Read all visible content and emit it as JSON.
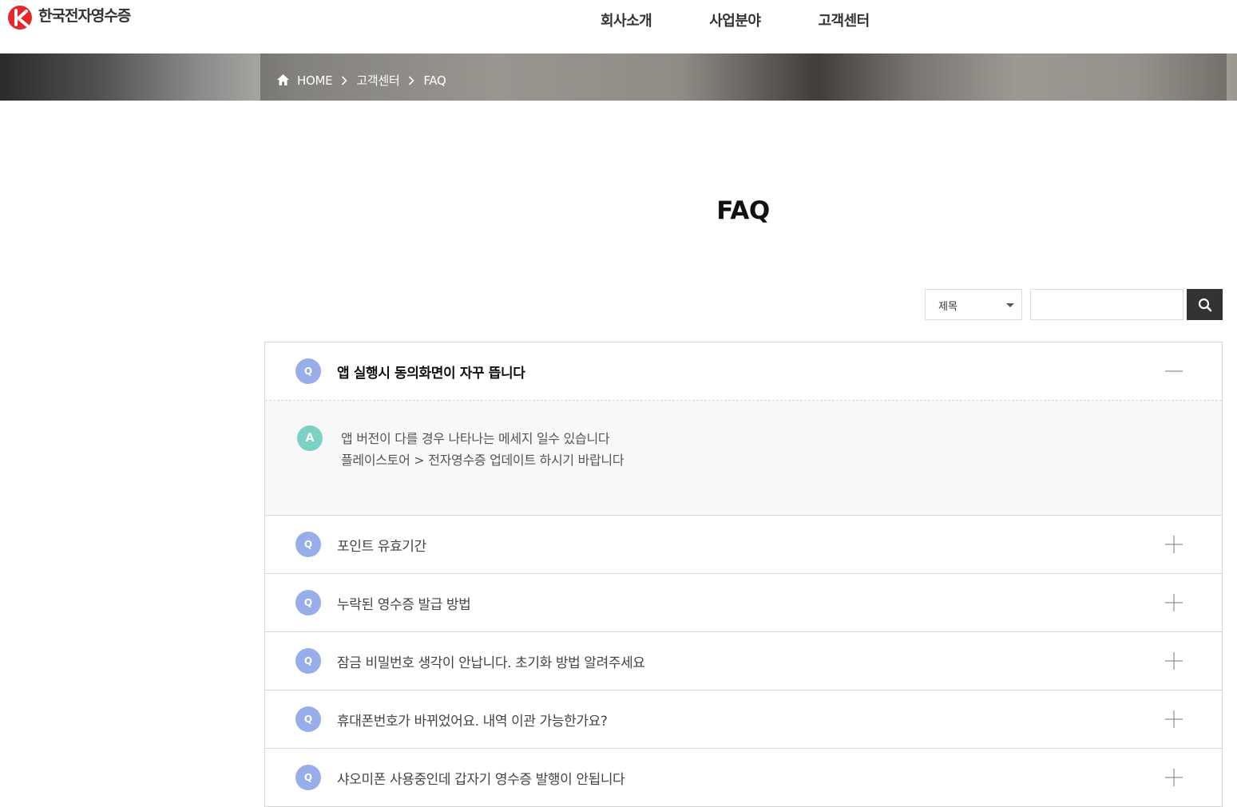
{
  "header": {
    "logo_text": "한국전자영수증",
    "nav": [
      {
        "label": "회사소개"
      },
      {
        "label": "사업분야"
      },
      {
        "label": "고객센터"
      }
    ]
  },
  "breadcrumb": {
    "home": "HOME",
    "section": "고객센터",
    "current": "FAQ"
  },
  "page": {
    "title": "FAQ"
  },
  "search": {
    "field_selected": "제목",
    "query": ""
  },
  "faq": [
    {
      "q_badge": "Q",
      "question": "앱 실행시 동의화면이 자꾸 뜹니다",
      "open": true,
      "a_badge": "A",
      "answer_line1": "앱 버전이 다를 경우 나타나는 메세지 일수 있습니다",
      "answer_line2": "플레이스토어 > 전자영수증  업데이트 하시기 바랍니다"
    },
    {
      "q_badge": "Q",
      "question": "포인트 유효기간",
      "open": false
    },
    {
      "q_badge": "Q",
      "question": "누락된 영수증 발급 방법",
      "open": false
    },
    {
      "q_badge": "Q",
      "question": "잠금 비밀번호 생각이 안납니다. 초기화 방법 알려주세요",
      "open": false
    },
    {
      "q_badge": "Q",
      "question": "휴대폰번호가 바뀌었어요. 내역 이관 가능한가요?",
      "open": false
    },
    {
      "q_badge": "Q",
      "question": "샤오미폰 사용중인데 갑자기 영수증 발행이 안됩니다",
      "open": false
    }
  ],
  "colors": {
    "q_badge": "#98aeea",
    "a_badge": "#7cd0c4",
    "logo_red": "#e8262c",
    "search_button": "#333333"
  }
}
